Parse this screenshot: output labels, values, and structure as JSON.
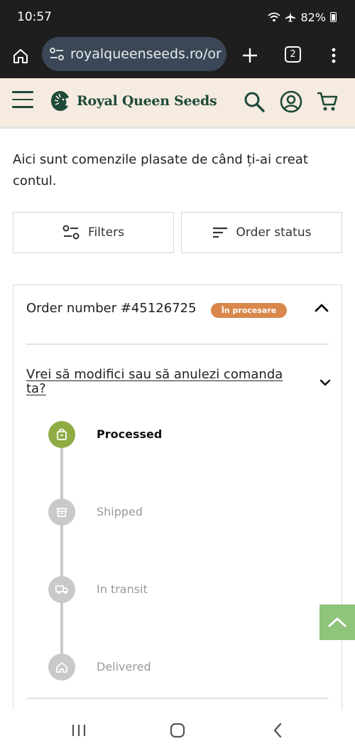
{
  "status_bar": {
    "time": "10:57",
    "battery": "82%"
  },
  "browser": {
    "url": "royalqueenseeds.ro/or",
    "tab_count": "2"
  },
  "site": {
    "logo_text": "Royal Queen Seeds"
  },
  "intro_text": "Aici sunt comenzile plasate de când ți-ai creat contul.",
  "filters": {
    "filters_label": "Filters",
    "order_status_label": "Order status"
  },
  "order": {
    "number_label": "Order number #45126725",
    "status_badge": "În procesare",
    "modify_link": "Vrei să modifici sau să anulezi comanda ta?",
    "steps": [
      {
        "label": "Processed",
        "icon": "bag-icon",
        "active": true
      },
      {
        "label": "Shipped",
        "icon": "box-icon",
        "active": false
      },
      {
        "label": "In transit",
        "icon": "truck-icon",
        "active": false
      },
      {
        "label": "Delivered",
        "icon": "home-icon",
        "active": false
      }
    ]
  },
  "colors": {
    "header_bg": "#f6ebe0",
    "brand_green": "#1f4a3a",
    "badge_orange": "#d9874a",
    "active_step": "#8fac44",
    "scroll_top_bg": "#8fc47b"
  }
}
